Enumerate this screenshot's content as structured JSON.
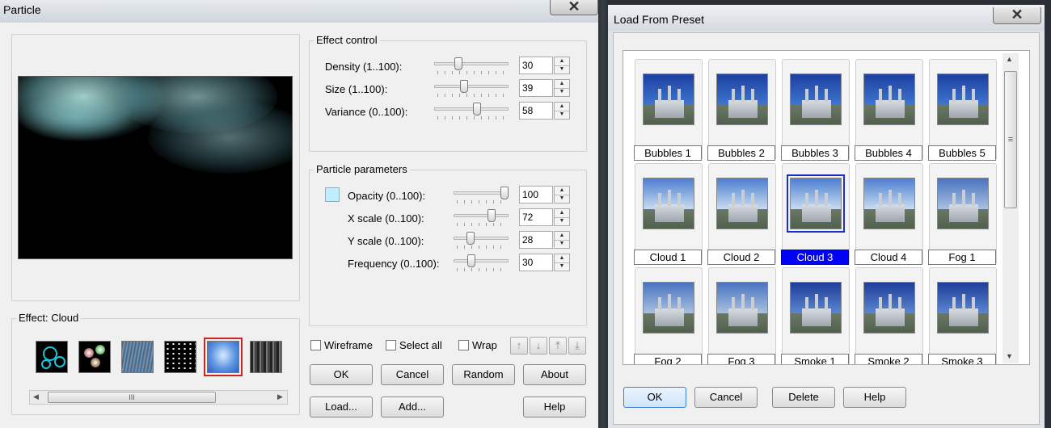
{
  "particle_window": {
    "title": "Particle",
    "close_glyph": "✕",
    "effect_label": "Effect: Cloud",
    "effect_thumbs": [
      "bubbles-icon",
      "sparkles-icon",
      "rain-icon",
      "stars-icon",
      "cloud-icon",
      "smoke-icon"
    ],
    "scroll_grip": "III",
    "effect_control": {
      "label": "Effect control",
      "rows": [
        {
          "label": "Density (1..100):",
          "value": "30",
          "level": 0.3
        },
        {
          "label": "Size (1..100):",
          "value": "39",
          "level": 0.39
        },
        {
          "label": "Variance (0..100):",
          "value": "58",
          "level": 0.58
        }
      ]
    },
    "particle_params": {
      "label": "Particle parameters",
      "swatch_color": "#bfeeff",
      "rows": [
        {
          "label": "Opacity (0..100):",
          "value": "100",
          "level": 1.0
        },
        {
          "label": "X scale (0..100):",
          "value": "72",
          "level": 0.72
        },
        {
          "label": "Y scale (0..100):",
          "value": "28",
          "level": 0.28
        },
        {
          "label": "Frequency (0..100):",
          "value": "30",
          "level": 0.3
        }
      ]
    },
    "checkboxes": {
      "wireframe": "Wireframe",
      "select_all": "Select all",
      "wrap": "Wrap"
    },
    "arrows": {
      "up": "↑",
      "down": "↓",
      "top": "⤒",
      "bottom": "⤓"
    },
    "buttons": {
      "ok": "OK",
      "cancel": "Cancel",
      "random": "Random",
      "about": "About",
      "load": "Load...",
      "add": "Add...",
      "help": "Help"
    }
  },
  "preset_window": {
    "title": "Load From Preset",
    "close_glyph": "✕",
    "presets": [
      [
        "Bubbles 1",
        "Bubbles 2",
        "Bubbles 3",
        "Bubbles 4",
        "Bubbles 5"
      ],
      [
        "Cloud 1",
        "Cloud 2",
        "Cloud 3",
        "Cloud 4",
        "Fog 1"
      ],
      [
        "Fog 2",
        "Fog 3",
        "Smoke 1",
        "Smoke 2",
        "Smoke 3"
      ]
    ],
    "selected": "Cloud 3",
    "scroll": {
      "up": "▲",
      "down": "▼",
      "grip": "≡"
    },
    "buttons": {
      "ok": "OK",
      "cancel": "Cancel",
      "delete": "Delete",
      "help": "Help"
    }
  }
}
